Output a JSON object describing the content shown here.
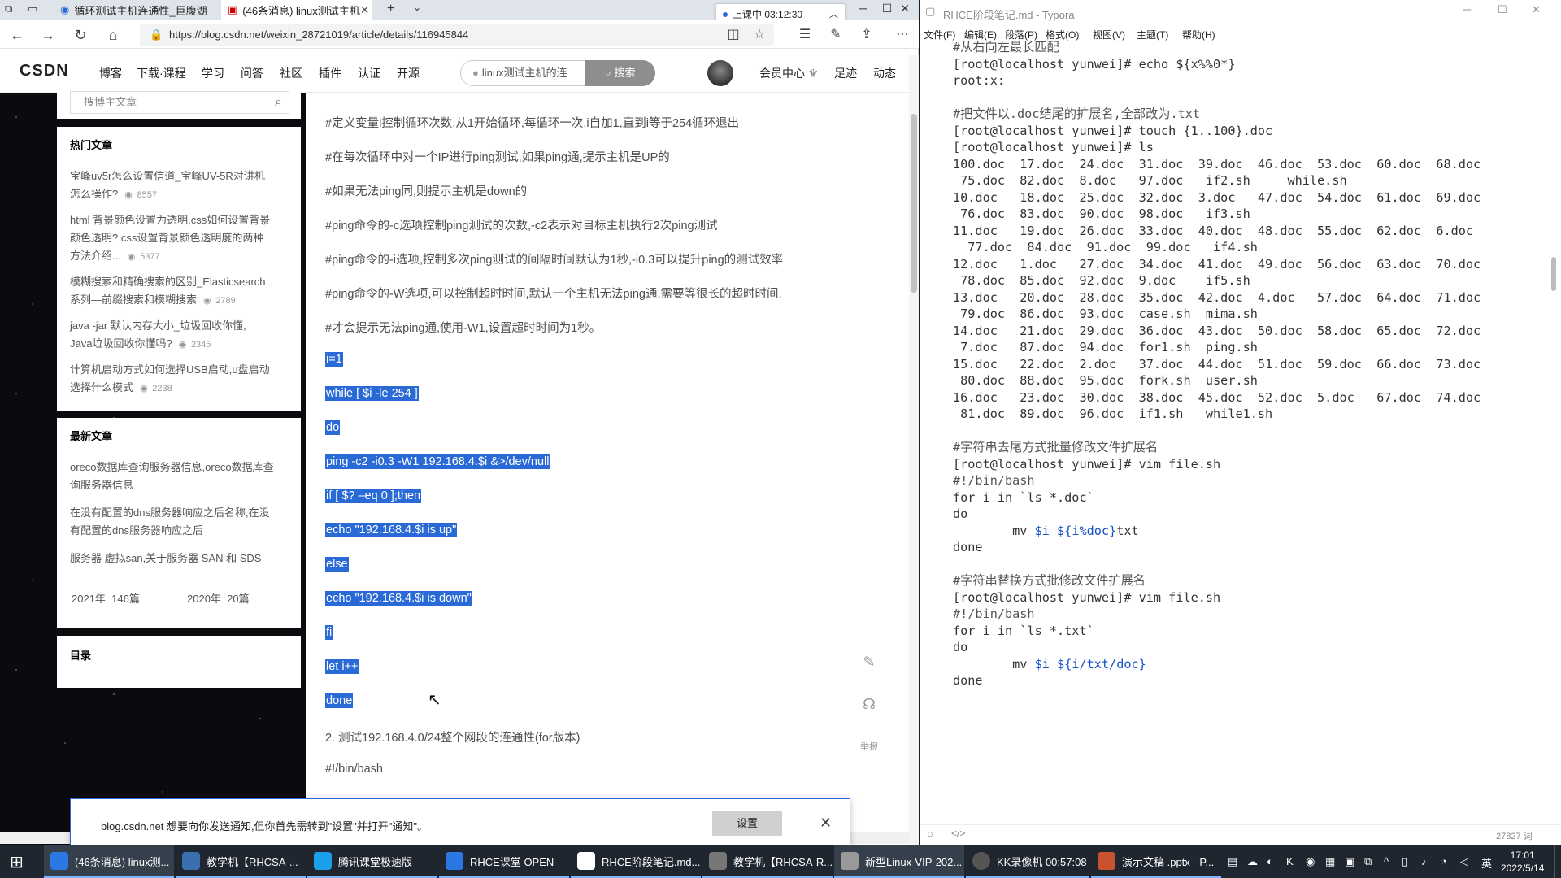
{
  "browser": {
    "tabs": [
      {
        "label": "循环测试主机连通性_巨腹湖"
      },
      {
        "label": "(46条消息) linux测试主机"
      }
    ],
    "url": "https://blog.csdn.net/weixin_28721019/article/details/116945844",
    "timer": "上课中 03:12:30"
  },
  "csdn": {
    "logo": "CSDN",
    "nav": [
      "博客",
      "下载·课程",
      "学习",
      "问答",
      "社区",
      "插件",
      "认证",
      "开源"
    ],
    "search_text": "linux测试主机的连",
    "search_button": "搜索",
    "right_nav": [
      "会员中心",
      "足迹",
      "动态"
    ]
  },
  "sidebar": {
    "search_placeholder": "搜博主文章",
    "hot_title": "热门文章",
    "hot": [
      {
        "line1": "宝峰uv5r怎么设置信道_宝峰UV-5R对讲机",
        "line2": "怎么操作?",
        "views": "8557"
      },
      {
        "line1": "html 背景颜色设置为透明,css如何设置背景",
        "line2": "颜色透明? css设置背景颜色透明度的两种",
        "line3": "方法介绍...",
        "views": "5377"
      },
      {
        "line1": "模糊搜索和精确搜索的区别_Elasticsearch",
        "line2": "系列—前缀搜索和模糊搜索",
        "views": "2789"
      },
      {
        "line1": "java -jar 默认内存大小_垃圾回收你懂,",
        "line2": "Java垃圾回收你懂吗?",
        "views": "2345"
      },
      {
        "line1": "计算机启动方式如何选择USB启动,u盘启动",
        "line2": "选择什么模式",
        "views": "2238"
      }
    ],
    "latest_title": "最新文章",
    "latest": [
      {
        "line1": "oreco数据库查询服务器信息,oreco数据库查",
        "line2": "询服务器信息"
      },
      {
        "line1": "在没有配置的dns服务器响应之后名称,在没",
        "line2": "有配置的dns服务器响应之后"
      },
      {
        "line1": "服务器 虚拟san,关于服务器 SAN 和 SDS"
      }
    ],
    "archive": [
      {
        "year": "2021年",
        "count": "146篇"
      },
      {
        "year": "2020年",
        "count": "20篇"
      }
    ],
    "toc_title": "目录"
  },
  "article": {
    "lines": [
      "#定义变量i控制循环次数,从1开始循环,每循环一次,i自加1,直到i等于254循环退出",
      "#在每次循环中对一个IP进行ping测试,如果ping通,提示主机是UP的",
      "#如果无法ping同,则提示主机是down的",
      "#ping命令的-c选项控制ping测试的次数,-c2表示对目标主机执行2次ping测试",
      "#ping命令的-i选项,控制多次ping测试的间隔时间默认为1秒,-i0.3可以提升ping的测试效率",
      "#ping命令的-W选项,可以控制超时时间,默认一个主机无法ping通,需要等很长的超时时间,",
      "#才会提示无法ping通,使用-W1,设置超时时间为1秒。"
    ],
    "code_lines": [
      "i=1",
      "while [ $i -le 254 ]",
      "do",
      "ping -c2 -i0.3 -W1 192.168.4.$i &>/dev/null",
      "if [ $? –eq 0 ];then",
      "echo \"192.168.4.$i is up\"",
      "else",
      "echo \"192.168.4.$i is down\"",
      "fi",
      "let i++",
      "done"
    ],
    "after_lines": [
      "2. 测试192.168.4.0/24整个网段的连通性(for版本)",
      "#!/bin/bash"
    ],
    "report_label": "举报"
  },
  "notification": {
    "text": "blog.csdn.net 想要向你发送通知,但你首先需转到\"设置\"并打开\"通知\"。",
    "button": "设置"
  },
  "typora": {
    "title": "RHCE阶段笔记.md - Typora",
    "menu": [
      "文件(F)",
      "编辑(E)",
      "段落(P)",
      "格式(O)",
      "视图(V)",
      "主题(T)",
      "帮助(H)"
    ],
    "code": [
      "#从右向左最长匹配",
      "[root@localhost yunwei]# echo ${x%%0*}",
      "root:x:",
      "",
      "#把文件以.doc结尾的扩展名,全部改为.txt",
      "[root@localhost yunwei]# touch {1..100}.doc",
      "[root@localhost yunwei]# ls",
      "100.doc  17.doc  24.doc  31.doc  39.doc  46.doc  53.doc  60.doc  68.doc",
      " 75.doc  82.doc  8.doc   97.doc   if2.sh     while.sh",
      "10.doc   18.doc  25.doc  32.doc  3.doc   47.doc  54.doc  61.doc  69.doc",
      " 76.doc  83.doc  90.doc  98.doc   if3.sh",
      "11.doc   19.doc  26.doc  33.doc  40.doc  48.doc  55.doc  62.doc  6.doc",
      "  77.doc  84.doc  91.doc  99.doc   if4.sh",
      "12.doc   1.doc   27.doc  34.doc  41.doc  49.doc  56.doc  63.doc  70.doc",
      " 78.doc  85.doc  92.doc  9.doc    if5.sh",
      "13.doc   20.doc  28.doc  35.doc  42.doc  4.doc   57.doc  64.doc  71.doc",
      " 79.doc  86.doc  93.doc  case.sh  mima.sh",
      "14.doc   21.doc  29.doc  36.doc  43.doc  50.doc  58.doc  65.doc  72.doc",
      " 7.doc   87.doc  94.doc  for1.sh  ping.sh",
      "15.doc   22.doc  2.doc   37.doc  44.doc  51.doc  59.doc  66.doc  73.doc",
      " 80.doc  88.doc  95.doc  fork.sh  user.sh",
      "16.doc   23.doc  30.doc  38.doc  45.doc  52.doc  5.doc   67.doc  74.doc",
      " 81.doc  89.doc  96.doc  if1.sh   while1.sh",
      "",
      "#字符串去尾方式批量修改文件扩展名",
      "[root@localhost yunwei]# vim file.sh",
      "#!/bin/bash",
      "for i in `ls *.doc`",
      "do",
      "        mv $i ${i%doc}txt",
      "done",
      "",
      "#字符串替换方式批修改文件扩展名",
      "[root@localhost yunwei]# vim file.sh",
      "#!/bin/bash",
      "for i in `ls *.txt`",
      "do",
      "        mv $i ${i/txt/doc}",
      "done"
    ],
    "word_count": "27827 词"
  },
  "taskbar": {
    "items": [
      {
        "label": "(46条消息) linux测..."
      },
      {
        "label": "教学机【RHCSA-..."
      },
      {
        "label": "腾讯课堂极速版"
      },
      {
        "label": "RHCE课堂 OPEN"
      },
      {
        "label": "RHCE阶段笔记.md..."
      },
      {
        "label": "教学机【RHCSA-R..."
      },
      {
        "label": "新型Linux-VIP-202..."
      },
      {
        "label": "KK录像机 00:57:08"
      },
      {
        "label": "演示文稿 .pptx - P..."
      }
    ],
    "ime": "英",
    "time": "17:01",
    "date": "2022/5/14"
  },
  "colors": {
    "selection": "#2a6ad6",
    "taskbar": "#1f2630",
    "var": "#1750c8"
  }
}
